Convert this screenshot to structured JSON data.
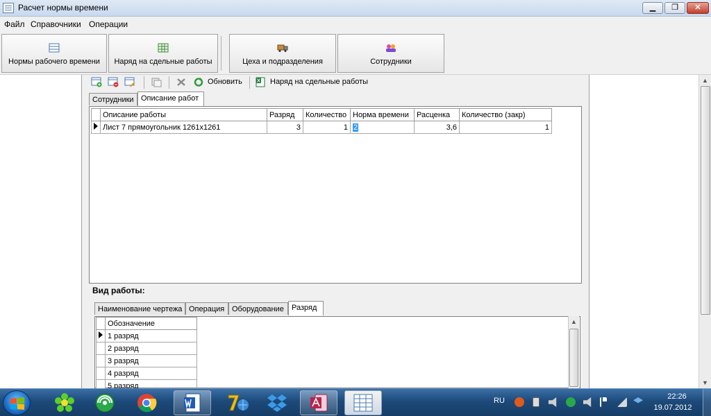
{
  "window": {
    "title": "Расчет нормы времени",
    "min": "▁",
    "max": "❐",
    "close": "✕"
  },
  "menu": [
    "Файл",
    "Справочники",
    "Операции"
  ],
  "toolbar": {
    "buttons": [
      {
        "label": "Нормы рабочего времени",
        "icon": "table-icon"
      },
      {
        "label": "Наряд на сдельные работы",
        "icon": "grid-icon"
      },
      {
        "label": "Цеха и подразделения",
        "icon": "truck-icon"
      },
      {
        "label": "Сотрудники",
        "icon": "people-icon"
      }
    ]
  },
  "inner_toolbar": {
    "refresh": "Обновить",
    "order": "Наряд на сдельные работы"
  },
  "tabs_top": [
    "Сотрудники",
    "Описание работ"
  ],
  "grid": {
    "columns": [
      "Описание работы",
      "Разряд",
      "Количество",
      "Норма времени",
      "Расценка",
      "Количество (закр)"
    ],
    "rows": [
      [
        "Лист 7 прямоугольник 1261x1261",
        "3",
        "1",
        "2",
        "3,6",
        "1"
      ]
    ]
  },
  "vid_label": "Вид работы:",
  "tabs_bottom": [
    "Наименование чертежа",
    "Операция",
    "Оборудование",
    "Разряд"
  ],
  "subgrid": {
    "column": "Обозначение",
    "rows": [
      "1 разряд",
      "2 разряд",
      "3 разряд",
      "4 разряд",
      "5 разряд"
    ]
  },
  "tray": {
    "lang": "RU",
    "time": "22:26",
    "date": "19.07.2012"
  }
}
